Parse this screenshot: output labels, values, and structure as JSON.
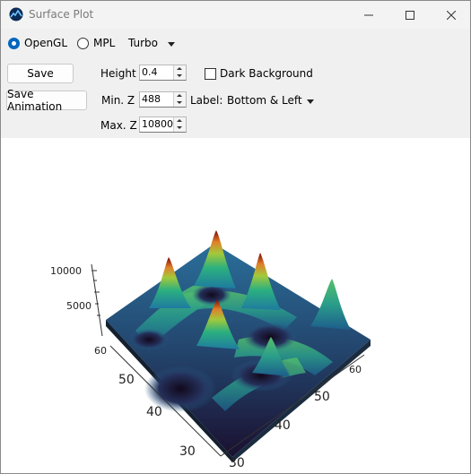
{
  "window": {
    "title": "Surface Plot"
  },
  "renderer": {
    "options": [
      {
        "label": "OpenGL",
        "checked": true
      },
      {
        "label": "MPL",
        "checked": false
      }
    ],
    "colormap": "Turbo"
  },
  "buttons": {
    "save": "Save",
    "save_animation": "Save Animation"
  },
  "controls": {
    "height_label": "Height",
    "height_value": "0.4",
    "dark_background_label": "Dark Background",
    "dark_background_checked": false,
    "min_z_label": "Min. Z",
    "min_z_value": "488",
    "max_z_label": "Max. Z",
    "max_z_value": "10800",
    "label_label": "Label:",
    "label_value": "Bottom & Left"
  },
  "plot": {
    "z_ticks": [
      "10000",
      "5000"
    ],
    "left_axis_ticks": [
      "60",
      "50",
      "40",
      "30"
    ],
    "bottom_axis_ticks": [
      "60",
      "50",
      "40",
      "30"
    ]
  },
  "colors": {
    "accent": "#0067c0",
    "surface_low": "#30123b",
    "surface_mid": "#1e6fa8",
    "surface_high": "#7a0403"
  }
}
